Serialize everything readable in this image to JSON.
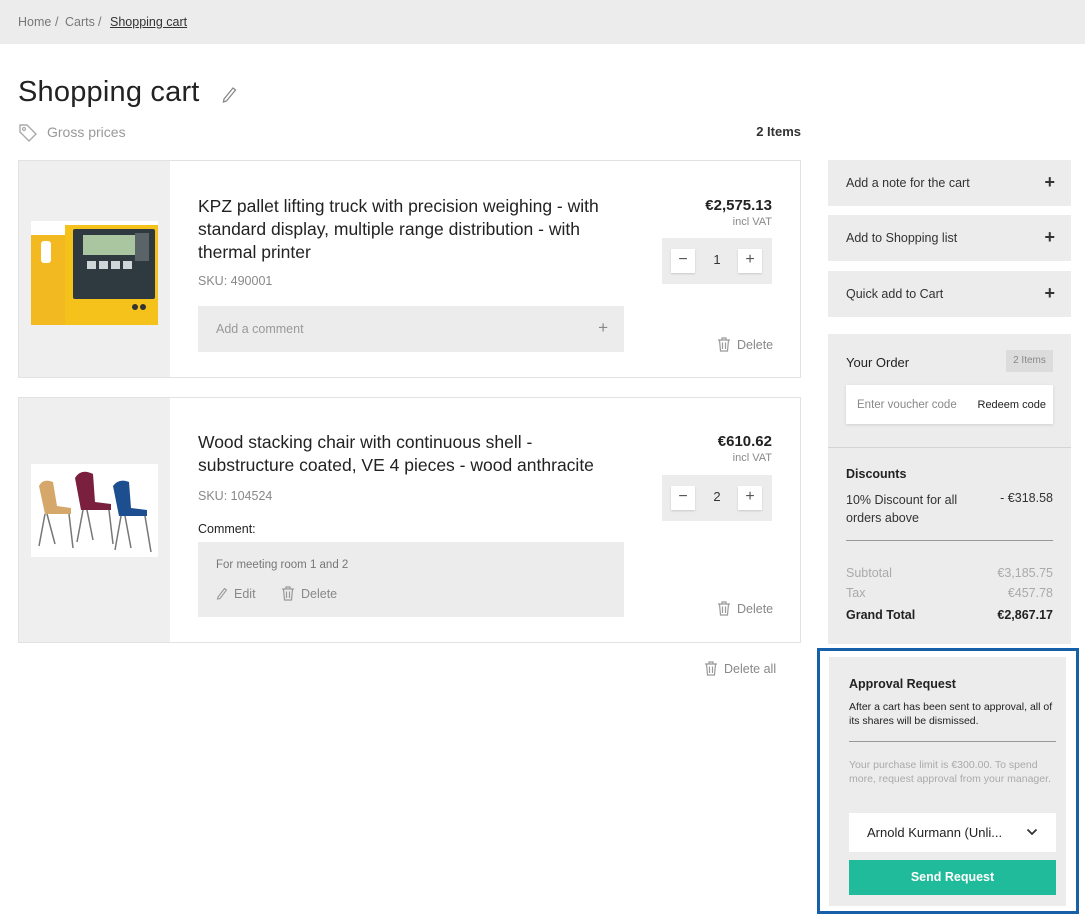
{
  "breadcrumb": {
    "home": "Home",
    "carts": "Carts",
    "current": "Shopping cart",
    "sep": "/"
  },
  "page": {
    "title": "Shopping cart",
    "gross_prices": "Gross prices",
    "items_count": "2 Items"
  },
  "items": [
    {
      "name": "KPZ pallet lifting truck with precision weighing - with standard display, multiple range distribution - with thermal printer",
      "sku": "SKU: 490001",
      "price": "€2,575.13",
      "vat": "incl VAT",
      "qty": "1",
      "comment_placeholder": "Add a comment",
      "delete": "Delete"
    },
    {
      "name": "Wood stacking chair with continuous shell - substructure coated, VE 4 pieces - wood anthracite",
      "sku": "SKU: 104524",
      "price": "€610.62",
      "vat": "incl VAT",
      "qty": "2",
      "comment_label": "Comment:",
      "comment_text": "For meeting room 1 and 2",
      "comment_edit": "Edit",
      "comment_delete": "Delete",
      "delete": "Delete"
    }
  ],
  "delete_all": "Delete all",
  "sidebar": {
    "actions": [
      "Add a note for the cart",
      "Add to Shopping list",
      "Quick add to Cart"
    ],
    "order": {
      "title": "Your Order",
      "badge": "2 Items",
      "voucher_placeholder": "Enter voucher code",
      "redeem": "Redeem code",
      "discounts_title": "Discounts",
      "discount_label": "10% Discount for all orders above",
      "discount_value": "- €318.58",
      "subtotal_label": "Subtotal",
      "subtotal_value": "€3,185.75",
      "tax_label": "Tax",
      "tax_value": "€457.78",
      "grand_label": "Grand Total",
      "grand_value": "€2,867.17"
    },
    "approval": {
      "title": "Approval Request",
      "note": "After a cart has been sent to approval, all of its shares will be dismissed.",
      "limit": "Your purchase limit is €300.00. To spend more, request approval from your manager.",
      "approver": "Arnold Kurmann (Unli...",
      "send": "Send Request"
    }
  },
  "colors": {
    "accent": "#1fbb9a",
    "highlight_border": "#1560a8",
    "panel": "#ececec"
  }
}
